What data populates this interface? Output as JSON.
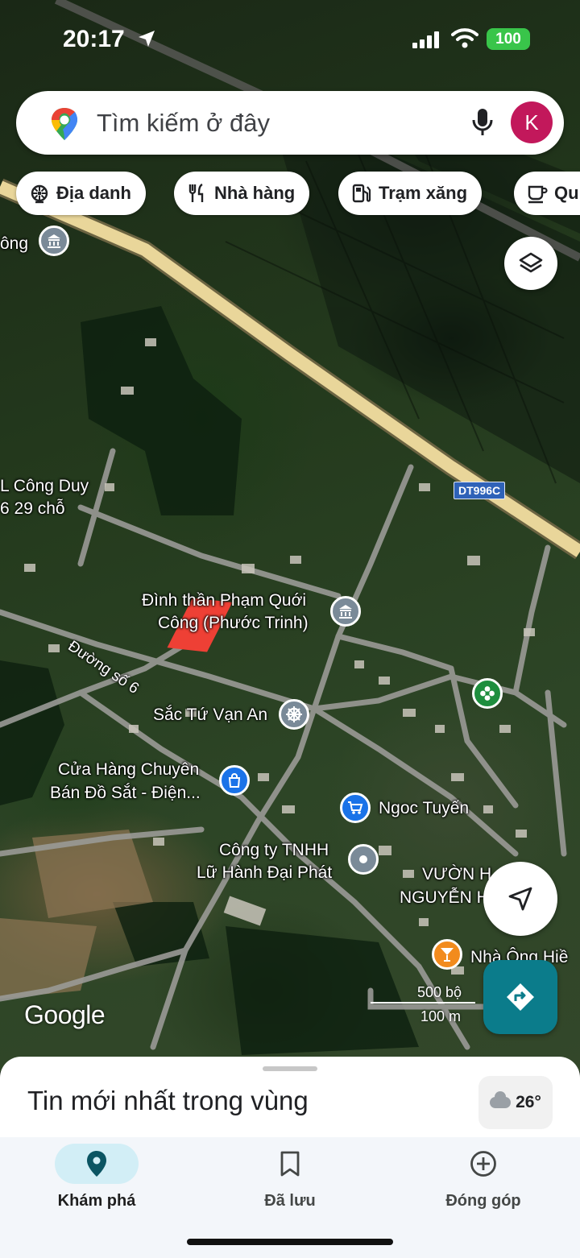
{
  "status_bar": {
    "time": "20:17",
    "battery": "100",
    "location_icon": "location-arrow-icon"
  },
  "search": {
    "placeholder": "Tìm kiếm ở đây",
    "avatar_letter": "K",
    "colors": {
      "avatar": "#c2185b"
    }
  },
  "chips": [
    {
      "label": "Địa danh",
      "icon": "landmark-icon"
    },
    {
      "label": "Nhà hàng",
      "icon": "restaurant-icon"
    },
    {
      "label": "Trạm xăng",
      "icon": "gas-station-icon"
    },
    {
      "label": "Qu",
      "icon": "coffee-icon"
    }
  ],
  "map": {
    "road_shield": "DT996C",
    "road_name": "Đường số 6",
    "labels": {
      "cong": "ông",
      "cong_duy_1": "L Công Duy",
      "cong_duy_2": "6 29 chỗ",
      "dinh_than_1": "Đình thần Phạm Quới",
      "dinh_than_2": "Công (Phước Trinh)",
      "sac_tu": "Sắc Tứ Vạn An",
      "cua_hang_1": "Cửa Hàng Chuyên",
      "cua_hang_2": "Bán Đồ Sắt - Điện...",
      "ngoc_tuyen": "Ngoc Tuyến",
      "cong_ty_1": "Công ty TNHH",
      "cong_ty_2": "Lữ Hành Đại Phát",
      "vuon_1": "VƯỜN H",
      "vuon_2": "NGUYỄN H",
      "nha_ong": "Nhà Ông Hiề"
    },
    "scale": {
      "imperial": "500 bộ",
      "metric": "100 m"
    },
    "attribution": "Google",
    "colors": {
      "highway": "#e9d69a",
      "parcel": "#ee4035",
      "shopping_pin": "#1a73e8",
      "bar_pin": "#f28b1d",
      "garden_pin": "#1e8e3e",
      "landmark_pin": "#7a8a98"
    }
  },
  "sheet": {
    "title": "Tin mới nhất trong vùng",
    "weather": "26°"
  },
  "nav": [
    {
      "label": "Khám phá",
      "icon": "explore-pin-icon",
      "active": true
    },
    {
      "label": "Đã lưu",
      "icon": "bookmark-icon",
      "active": false
    },
    {
      "label": "Đóng góp",
      "icon": "add-circle-icon",
      "active": false
    }
  ]
}
